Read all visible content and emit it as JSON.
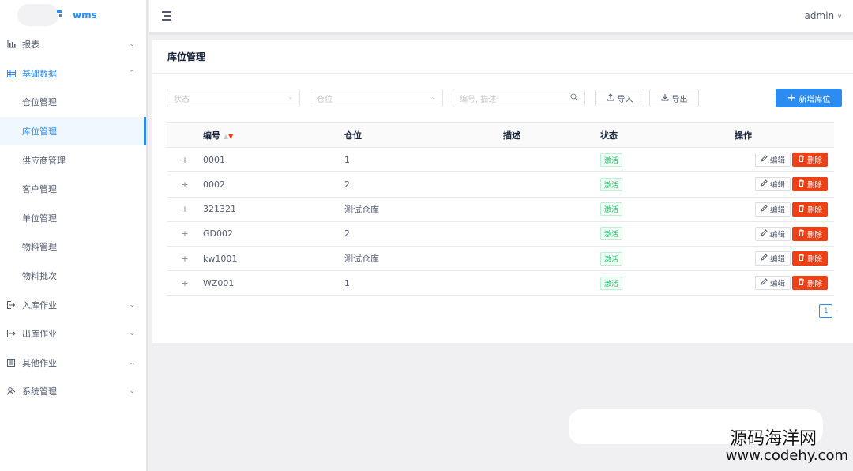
{
  "app": {
    "logo_text": "wms",
    "user": "admin"
  },
  "sidebar": {
    "items": [
      {
        "label": "报表",
        "icon": "bar-chart-icon",
        "expanded": false
      },
      {
        "label": "基础数据",
        "icon": "table-icon",
        "expanded": true,
        "children": [
          "仓位管理",
          "库位管理",
          "供应商管理",
          "客户管理",
          "单位管理",
          "物料管理",
          "物料批次"
        ],
        "active_child": "库位管理"
      },
      {
        "label": "入库作业",
        "icon": "login-icon",
        "expanded": false
      },
      {
        "label": "出库作业",
        "icon": "logout-icon",
        "expanded": false
      },
      {
        "label": "其他作业",
        "icon": "list-icon",
        "expanded": false
      },
      {
        "label": "系统管理",
        "icon": "settings-icon",
        "expanded": false
      }
    ]
  },
  "page": {
    "title": "库位管理"
  },
  "filters": {
    "status_placeholder": "状态",
    "warehouse_placeholder": "仓位",
    "search_placeholder": "编号, 描述"
  },
  "toolbar": {
    "import_label": "导入",
    "export_label": "导出",
    "add_label": "新增库位"
  },
  "table": {
    "columns": [
      "编号",
      "仓位",
      "描述",
      "状态",
      "操作"
    ],
    "rows": [
      {
        "code": "0001",
        "warehouse": "1",
        "desc": "",
        "status": "激活"
      },
      {
        "code": "0002",
        "warehouse": "2",
        "desc": "",
        "status": "激活"
      },
      {
        "code": "321321",
        "warehouse": "测试仓库",
        "desc": "",
        "status": "激活"
      },
      {
        "code": "GD002",
        "warehouse": "2",
        "desc": "",
        "status": "激活"
      },
      {
        "code": "kw1001",
        "warehouse": "测试仓库",
        "desc": "",
        "status": "激活"
      },
      {
        "code": "WZ001",
        "warehouse": "1",
        "desc": "",
        "status": "激活"
      }
    ],
    "expand_symbol": "+",
    "edit_label": "编辑",
    "delete_label": "删除"
  },
  "pagination": {
    "current": "1"
  },
  "watermark": {
    "line1": "源码海洋网",
    "line2": "www.codehy.com"
  },
  "colors": {
    "primary": "#2d8cf0",
    "danger": "#ed4014",
    "success": "#19be6b"
  }
}
